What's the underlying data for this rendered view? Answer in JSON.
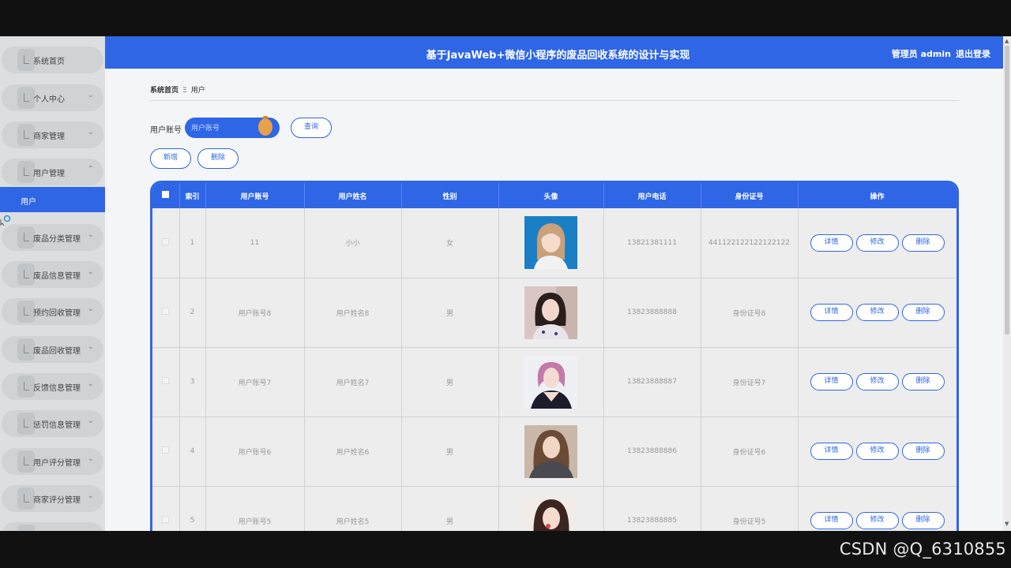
{
  "header": {
    "title": "基于JavaWeb+微信小程序的废品回收系统的设计与实现",
    "role": "管理员 admin",
    "logout": "退出登录"
  },
  "sidebar": {
    "items": [
      {
        "label": "系统首页",
        "chevron": ""
      },
      {
        "label": "个人中心",
        "chevron": "⌄"
      },
      {
        "label": "商家管理",
        "chevron": "⌄"
      },
      {
        "label": "用户管理",
        "chevron": "⌃"
      },
      {
        "label": "废品分类管理",
        "chevron": "⌄"
      },
      {
        "label": "废品信息管理",
        "chevron": "⌄"
      },
      {
        "label": "预约回收管理",
        "chevron": "⌄"
      },
      {
        "label": "废品回收管理",
        "chevron": "⌄"
      },
      {
        "label": "反馈信息管理",
        "chevron": "⌄"
      },
      {
        "label": "惩罚信息管理",
        "chevron": "⌄"
      },
      {
        "label": "用户评分管理",
        "chevron": "⌄"
      },
      {
        "label": "商家评分管理",
        "chevron": "⌄"
      }
    ],
    "submenu_active": "用户"
  },
  "breadcrumb": {
    "home": "系统首页",
    "separator": "Ξ",
    "current": "用户"
  },
  "search": {
    "label": "用户账号",
    "placeholder": "用户账号",
    "query_button": "查询"
  },
  "actions": {
    "add": "新增",
    "delete": "删除"
  },
  "table": {
    "headers": [
      "索引",
      "用户账号",
      "用户姓名",
      "性别",
      "头像",
      "用户电话",
      "身份证号",
      "操作"
    ],
    "rows": [
      {
        "index": "1",
        "account": "11",
        "name": "小小",
        "gender": "女",
        "phone": "13821381111",
        "id_card": "441122122122122122"
      },
      {
        "index": "2",
        "account": "用户账号8",
        "name": "用户姓名8",
        "gender": "男",
        "phone": "13823888888",
        "id_card": "身份证号8"
      },
      {
        "index": "3",
        "account": "用户账号7",
        "name": "用户姓名7",
        "gender": "男",
        "phone": "13823888887",
        "id_card": "身份证号7"
      },
      {
        "index": "4",
        "account": "用户账号6",
        "name": "用户姓名6",
        "gender": "男",
        "phone": "13823888886",
        "id_card": "身份证号6"
      },
      {
        "index": "5",
        "account": "用户账号5",
        "name": "用户姓名5",
        "gender": "男",
        "phone": "13823888885",
        "id_card": "身份证号5"
      }
    ],
    "ops": {
      "detail": "详情",
      "edit": "修改",
      "delete": "删除"
    }
  },
  "watermark": "CSDN @Q_6310855",
  "colors": {
    "primary": "#2e66e6",
    "sidebar_bg": "#dcdedf",
    "page_bg": "#f4f5f7"
  }
}
